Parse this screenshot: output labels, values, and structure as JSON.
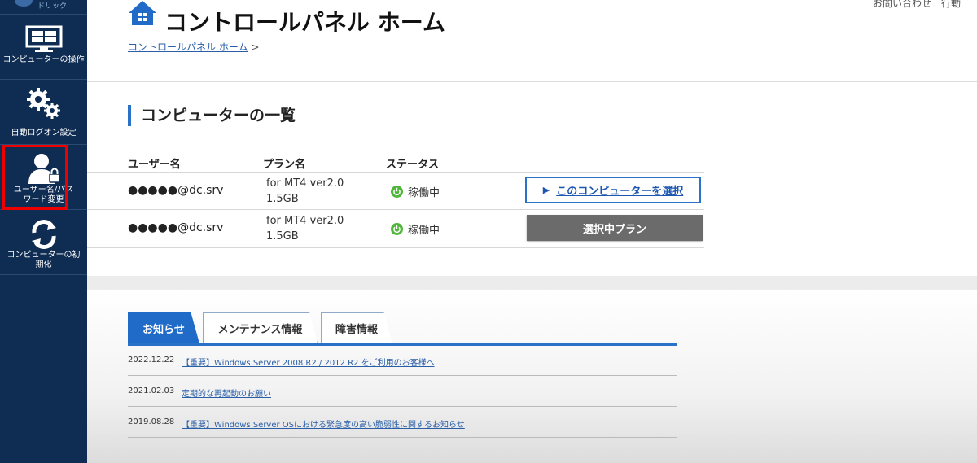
{
  "sidebar": {
    "top_text": "ドリック",
    "items": [
      {
        "label": "コンピューターの操作",
        "icon": "monitor-icon"
      },
      {
        "label": "自動ログオン設定",
        "icon": "gears-icon"
      },
      {
        "label": "ユーザー名/パスワード変更",
        "icon": "user-lock-icon",
        "highlighted": true
      },
      {
        "label": "コンピューターの初期化",
        "icon": "refresh-icon"
      }
    ]
  },
  "header": {
    "title": "コントロールパネル ホーム",
    "breadcrumb": "コントロールパネル ホーム",
    "breadcrumb_sep": ">",
    "top_right": "お問い合わせ　行動"
  },
  "computers": {
    "title": "コンピューターの一覧",
    "columns": [
      "ユーザー名",
      "プラン名",
      "ステータス"
    ],
    "rows": [
      {
        "user": "●●●●●@dc.srv",
        "plan_line1": "for MT4 ver2.0",
        "plan_line2": "1.5GB",
        "status": "稼働中",
        "action": "このコンピューターを選択",
        "action_type": "select"
      },
      {
        "user": "●●●●●@dc.srv",
        "plan_line1": "for MT4 ver2.0",
        "plan_line2": "1.5GB",
        "status": "稼働中",
        "action": "選択中プラン",
        "action_type": "selected"
      }
    ]
  },
  "news": {
    "tabs": [
      "お知らせ",
      "メンテナンス情報",
      "障害情報"
    ],
    "items": [
      {
        "date": "2022.12.22",
        "text": "【重要】Windows Server 2008 R2 / 2012 R2 をご利用のお客様へ"
      },
      {
        "date": "2021.02.03",
        "text": "定期的な再起動のお願い"
      },
      {
        "date": "2019.08.28",
        "text": "【重要】Windows Server OSにおける緊急度の高い脆弱性に関するお知らせ"
      }
    ]
  },
  "colors": {
    "sidebar": "#0f2c52",
    "accent": "#2a72c8",
    "status_green": "#4fb53b",
    "highlight_red": "#e00000",
    "selected_button": "#6b6b6b"
  }
}
